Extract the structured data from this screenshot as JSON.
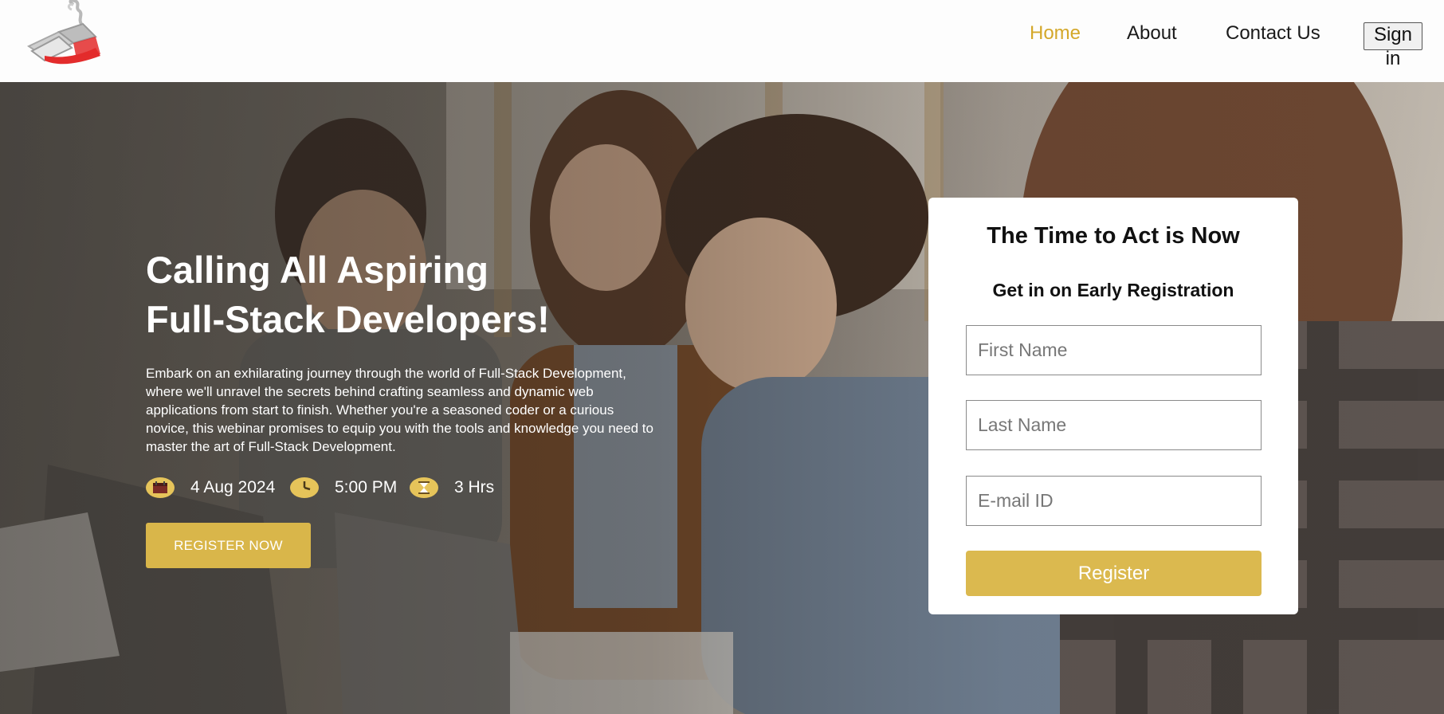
{
  "header": {
    "logo_icon": "book-logo-icon",
    "nav": {
      "home": "Home",
      "about": "About",
      "contact": "Contact Us",
      "signin": "Sign in"
    },
    "active_color": "#d4a82a"
  },
  "hero": {
    "title_line1": "Calling All Aspiring",
    "title_line2": "Full-Stack Developers!",
    "description": "Embark on an exhilarating journey through the world of Full-Stack Development, where we'll unravel the secrets behind crafting seamless and dynamic web applications from start to finish. Whether you're a seasoned coder or a curious novice, this webinar promises to equip you with the tools and knowledge you need to master the art of Full-Stack Development.",
    "date": "4 Aug 2024",
    "time": "5:00 PM",
    "duration": "3 Hrs",
    "date_icon": "calendar-icon",
    "time_icon": "clock-icon",
    "duration_icon": "hourglass-icon",
    "cta": "REGISTER NOW",
    "accent": "#d9b64a"
  },
  "form": {
    "title": "The Time to Act is Now",
    "subtitle": "Get in on Early Registration",
    "first_name_placeholder": "First Name",
    "last_name_placeholder": "Last Name",
    "email_placeholder": "E-mail ID",
    "submit": "Register"
  }
}
